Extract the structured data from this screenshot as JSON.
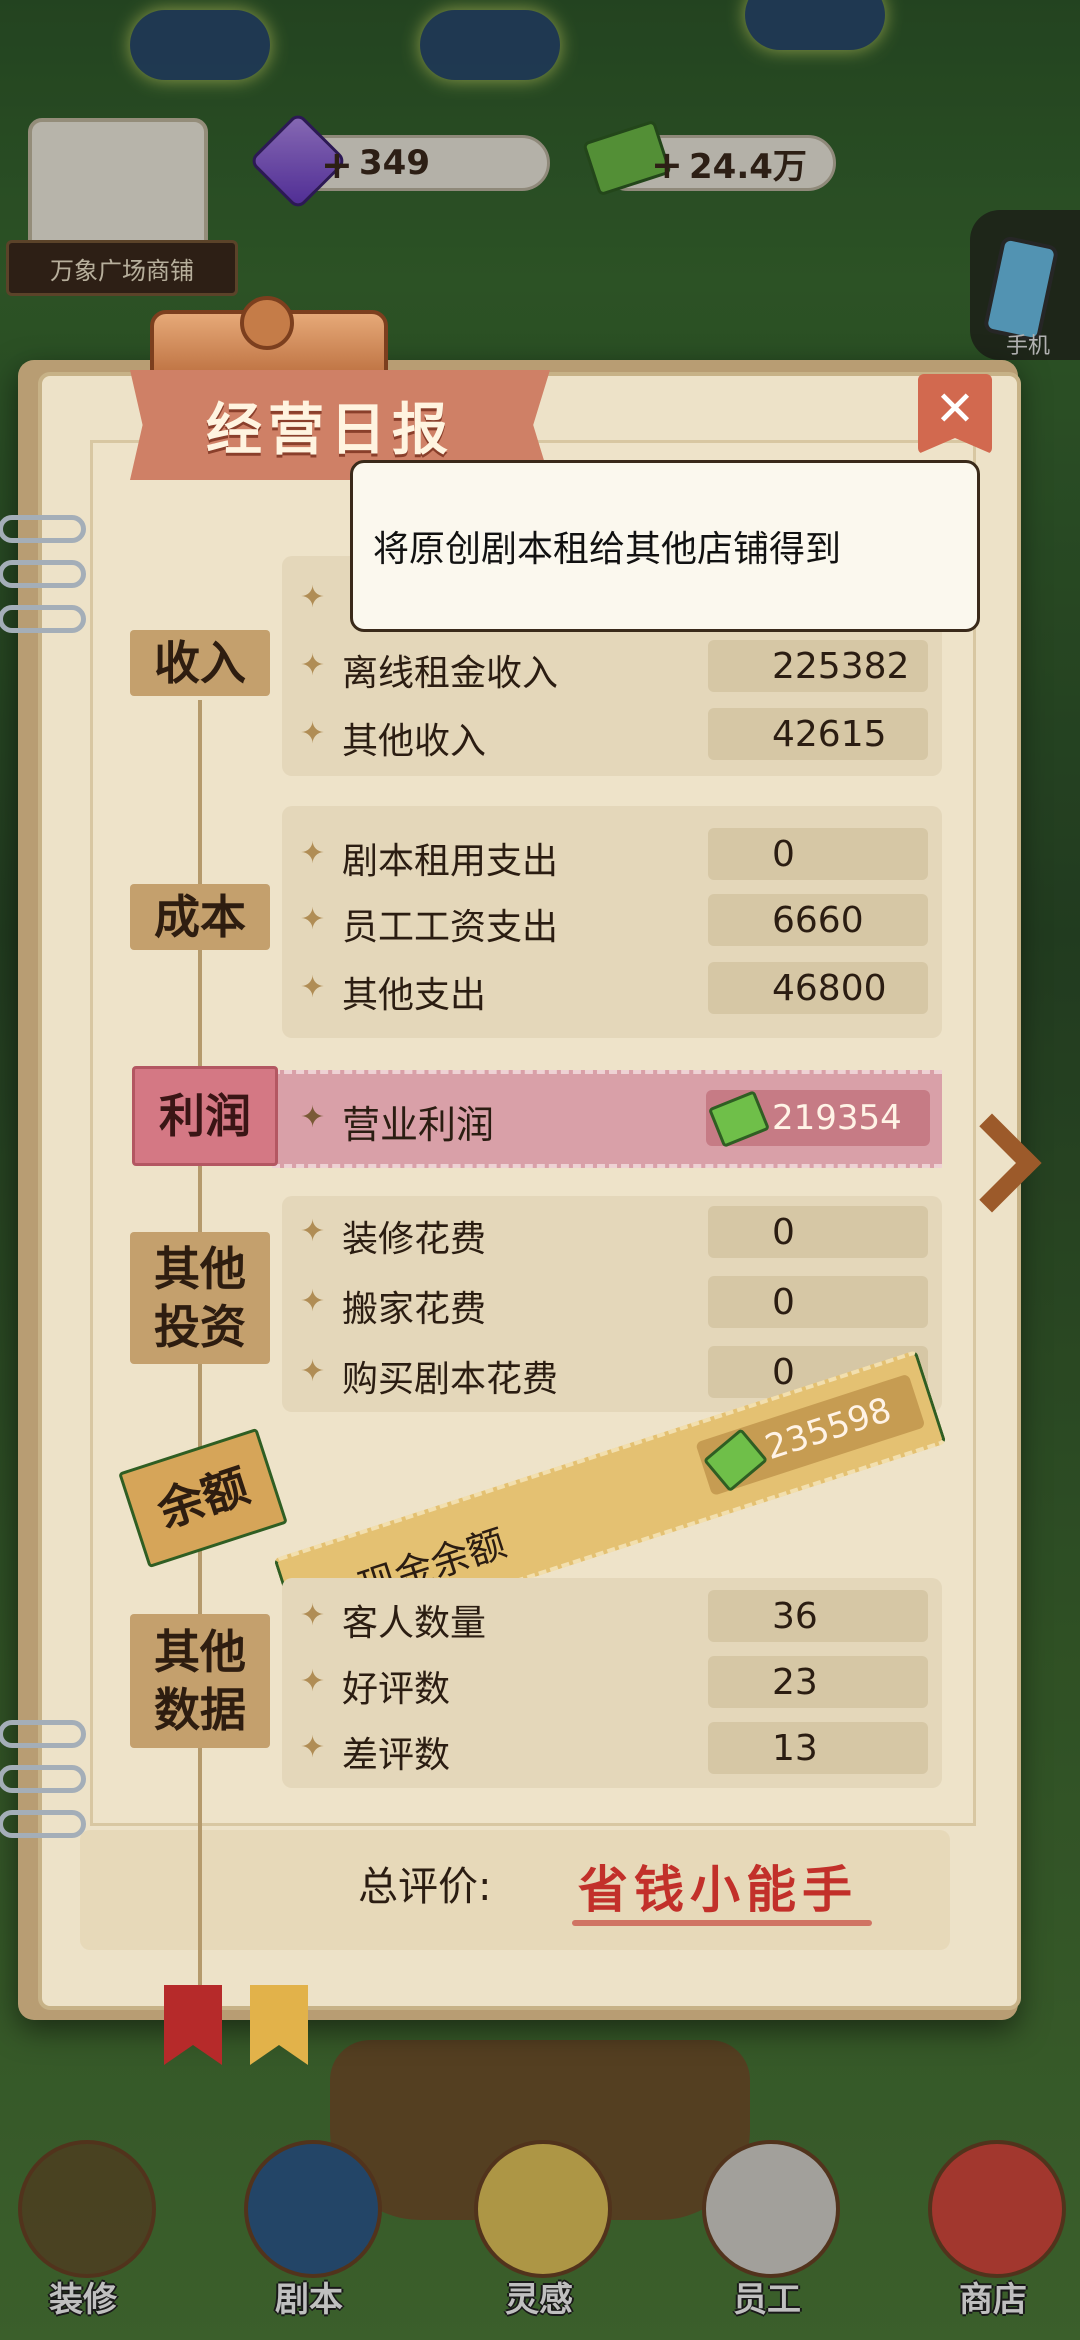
{
  "hud": {
    "gems": "349",
    "cash": "24.4万",
    "shop_name": "万象广场商铺",
    "phone_label": "手机"
  },
  "report": {
    "title": "经营日报",
    "close_symbol": "✕",
    "tooltip": "将原创剧本租给其他店铺得到",
    "sections": {
      "income": {
        "category": "收入",
        "rows": [
          {
            "label": "离线租金收入",
            "value": "225382"
          },
          {
            "label": "其他收入",
            "value": "42615"
          }
        ]
      },
      "cost": {
        "category": "成本",
        "rows": [
          {
            "label": "剧本租用支出",
            "value": "0"
          },
          {
            "label": "员工工资支出",
            "value": "6660"
          },
          {
            "label": "其他支出",
            "value": "46800"
          }
        ]
      },
      "profit": {
        "category": "利润",
        "label": "营业利润",
        "value": "219354"
      },
      "investment": {
        "category_line1": "其他",
        "category_line2": "投资",
        "rows": [
          {
            "label": "装修花费",
            "value": "0"
          },
          {
            "label": "搬家花费",
            "value": "0"
          },
          {
            "label": "购买剧本花费",
            "value": "0"
          }
        ]
      },
      "balance": {
        "category": "余额",
        "label": "现金余额",
        "value": "235598"
      },
      "other_data": {
        "category_line1": "其他",
        "category_line2": "数据",
        "rows": [
          {
            "label": "客人数量",
            "value": "36"
          },
          {
            "label": "好评数",
            "value": "23"
          },
          {
            "label": "差评数",
            "value": "13"
          }
        ]
      }
    },
    "evaluation": {
      "label": "总评价:",
      "value": "省钱小能手"
    }
  },
  "nav": [
    {
      "label": "装修",
      "icon": "house-icon"
    },
    {
      "label": "剧本",
      "icon": "script-book-icon"
    },
    {
      "label": "灵感",
      "icon": "lightbulb-icon"
    },
    {
      "label": "员工",
      "icon": "staff-card-icon"
    },
    {
      "label": "商店",
      "icon": "shop-icon"
    }
  ],
  "colors": {
    "profit_band": "#d9a0a8",
    "cash_band": "#e4c172",
    "category_tag": "#c4a06d",
    "evaluation_text": "#c2302a"
  }
}
